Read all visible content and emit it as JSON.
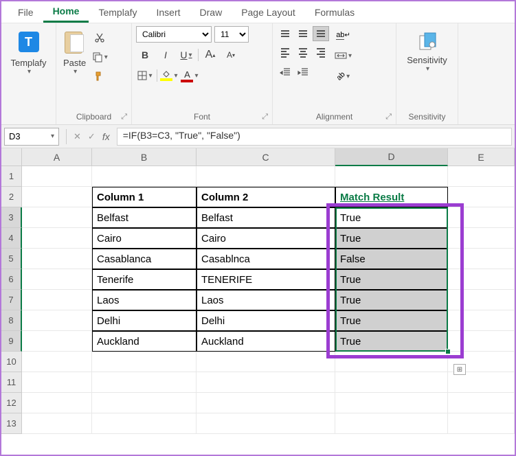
{
  "ribbon": {
    "tabs": [
      "File",
      "Home",
      "Templafy",
      "Insert",
      "Draw",
      "Page Layout",
      "Formulas"
    ],
    "active_tab": "Home",
    "groups": {
      "templafy": {
        "label": "Templafy",
        "button": "Templafy"
      },
      "clipboard": {
        "label": "Clipboard",
        "paste": "Paste"
      },
      "font": {
        "label": "Font",
        "family": "Calibri",
        "size": "11",
        "bold": "B",
        "italic": "I",
        "underline": "U",
        "grow": "A",
        "shrink": "A"
      },
      "alignment": {
        "label": "Alignment",
        "wrap": "ab"
      },
      "sensitivity": {
        "label": "Sensitivity",
        "button": "Sensitivity"
      }
    }
  },
  "formula_bar": {
    "name_box": "D3",
    "formula": "=IF(B3=C3, \"True\", \"False\")"
  },
  "columns": [
    "A",
    "B",
    "C",
    "D",
    "E"
  ],
  "rows": [
    "1",
    "2",
    "3",
    "4",
    "5",
    "6",
    "7",
    "8",
    "9",
    "10",
    "11",
    "12",
    "13"
  ],
  "data": {
    "headers": {
      "col1": "Column 1",
      "col2": "Column 2",
      "match": "Match Result"
    },
    "rows": [
      {
        "col1": "Belfast",
        "col2": "Belfast",
        "match": "True"
      },
      {
        "col1": "Cairo",
        "col2": "Cairo",
        "match": "True"
      },
      {
        "col1": "Casablanca",
        "col2": "Casablnca",
        "match": "False"
      },
      {
        "col1": "Tenerife",
        "col2": "TENERIFE",
        "match": "True"
      },
      {
        "col1": "Laos",
        "col2": "Laos",
        "match": "True"
      },
      {
        "col1": "Delhi",
        "col2": "Delhi",
        "match": "True"
      },
      {
        "col1": "Auckland",
        "col2": "Auckland",
        "match": "True"
      }
    ]
  },
  "selection": {
    "active_cell": "D3",
    "range": "D3:D9"
  }
}
